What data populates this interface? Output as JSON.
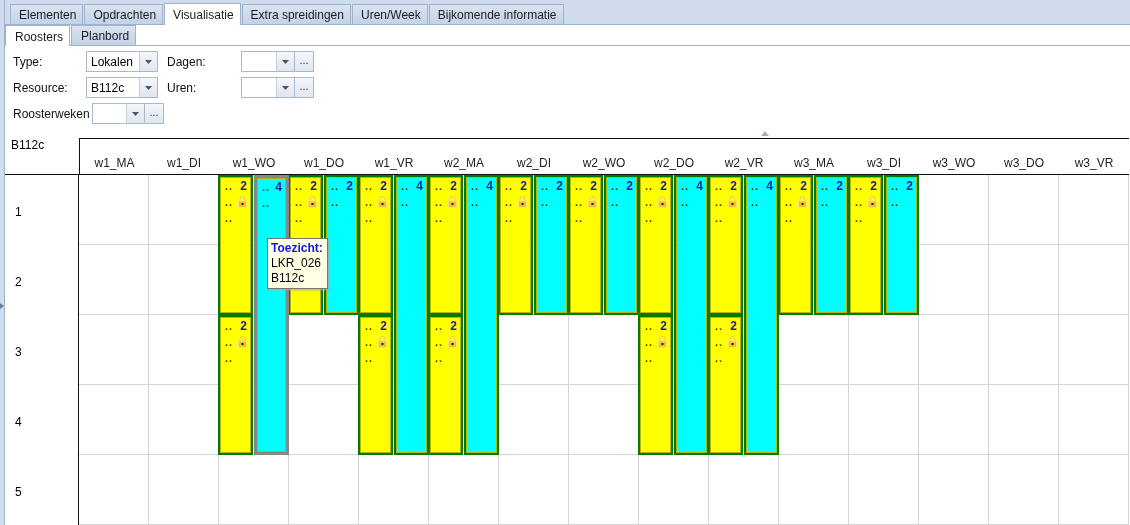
{
  "tabs": [
    {
      "label": "Elementen",
      "selected": false
    },
    {
      "label": "Opdrachten",
      "selected": false
    },
    {
      "label": "Visualisatie",
      "selected": true
    },
    {
      "label": "Extra spreidingen",
      "selected": false
    },
    {
      "label": "Uren/Week",
      "selected": false
    },
    {
      "label": "Bijkomende informatie",
      "selected": false
    }
  ],
  "subtabs": [
    {
      "label": "Roosters",
      "selected": true
    },
    {
      "label": "Planbord",
      "selected": false
    }
  ],
  "filters": [
    [
      {
        "label": "Type:",
        "value": "Lokalen",
        "kind": "combo"
      },
      {
        "label": "Dagen:",
        "kind": "combo-browse",
        "browse": "..."
      }
    ],
    [
      {
        "label": "Resource:",
        "value": "B112c",
        "kind": "combo"
      },
      {
        "label": "Uren:",
        "kind": "combo-browse",
        "browse": "..."
      }
    ],
    [
      {
        "label": "Roosterweken",
        "kind": "combo-browse",
        "browse": "..."
      }
    ]
  ],
  "schedule": {
    "resource": "B112c",
    "rows": [
      "1",
      "2",
      "3",
      "4",
      "5"
    ],
    "columns": [
      {
        "label": "w1_MA"
      },
      {
        "label": "w1_DI"
      },
      {
        "label": "w1_WO",
        "lanes": [
          [
            {
              "kind": "start",
              "color": "#ffff00",
              "count": "2",
              "lines": [
                "..",
                "..",
                ".."
              ],
              "locked": true,
              "selected": false
            },
            {
              "kind": "continued"
            },
            {
              "kind": "start",
              "color": "#ffff00",
              "count": "2",
              "lines": [
                "..",
                "..",
                ".."
              ],
              "locked": true,
              "selected": false
            },
            {
              "kind": "continued"
            },
            {
              "kind": "empty"
            }
          ],
          [
            {
              "kind": "start",
              "color": "#00ffff",
              "count": "4",
              "lines": [
                "..",
                ".."
              ],
              "locked": false,
              "selected": true
            },
            {
              "kind": "continued"
            },
            {
              "kind": "continued"
            },
            {
              "kind": "continued"
            },
            {
              "kind": "empty"
            }
          ]
        ]
      },
      {
        "label": "w1_DO",
        "lanes": [
          [
            {
              "kind": "start",
              "color": "#ffff00",
              "count": "2",
              "lines": [
                "..",
                "..",
                ".."
              ],
              "locked": true,
              "selected": false
            },
            {
              "kind": "continued"
            },
            {
              "kind": "empty"
            },
            {
              "kind": "empty"
            },
            {
              "kind": "empty"
            }
          ],
          [
            {
              "kind": "start",
              "color": "#00ffff",
              "count": "2",
              "lines": [
                "..",
                ".."
              ],
              "locked": false,
              "selected": false
            },
            {
              "kind": "continued"
            },
            {
              "kind": "empty"
            },
            {
              "kind": "empty"
            },
            {
              "kind": "empty"
            }
          ]
        ]
      },
      {
        "label": "w1_VR",
        "lanes": [
          [
            {
              "kind": "start",
              "color": "#ffff00",
              "count": "2",
              "lines": [
                "..",
                "..",
                ".."
              ],
              "locked": true,
              "selected": false
            },
            {
              "kind": "continued"
            },
            {
              "kind": "start",
              "color": "#ffff00",
              "count": "2",
              "lines": [
                "..",
                "..",
                ".."
              ],
              "locked": true,
              "selected": false
            },
            {
              "kind": "continued"
            },
            {
              "kind": "empty"
            }
          ],
          [
            {
              "kind": "start",
              "color": "#00ffff",
              "count": "4",
              "lines": [
                "..",
                ".."
              ],
              "locked": false,
              "selected": false
            },
            {
              "kind": "continued"
            },
            {
              "kind": "continued"
            },
            {
              "kind": "continued"
            },
            {
              "kind": "empty"
            }
          ]
        ]
      },
      {
        "label": "w2_MA",
        "lanes": [
          [
            {
              "kind": "start",
              "color": "#ffff00",
              "count": "2",
              "lines": [
                "..",
                "..",
                ".."
              ],
              "locked": true,
              "selected": false
            },
            {
              "kind": "continued"
            },
            {
              "kind": "start",
              "color": "#ffff00",
              "count": "2",
              "lines": [
                "..",
                "..",
                ".."
              ],
              "locked": true,
              "selected": false
            },
            {
              "kind": "continued"
            },
            {
              "kind": "empty"
            }
          ],
          [
            {
              "kind": "start",
              "color": "#00ffff",
              "count": "4",
              "lines": [
                "..",
                ".."
              ],
              "locked": false,
              "selected": false
            },
            {
              "kind": "continued"
            },
            {
              "kind": "continued"
            },
            {
              "kind": "continued"
            },
            {
              "kind": "empty"
            }
          ]
        ]
      },
      {
        "label": "w2_DI",
        "lanes": [
          [
            {
              "kind": "start",
              "color": "#ffff00",
              "count": "2",
              "lines": [
                "..",
                "..",
                ".."
              ],
              "locked": true,
              "selected": false
            },
            {
              "kind": "continued"
            },
            {
              "kind": "empty"
            },
            {
              "kind": "empty"
            },
            {
              "kind": "empty"
            }
          ],
          [
            {
              "kind": "start",
              "color": "#00ffff",
              "count": "2",
              "lines": [
                "..",
                ".."
              ],
              "locked": false,
              "selected": false
            },
            {
              "kind": "continued"
            },
            {
              "kind": "empty"
            },
            {
              "kind": "empty"
            },
            {
              "kind": "empty"
            }
          ]
        ]
      },
      {
        "label": "w2_WO",
        "lanes": [
          [
            {
              "kind": "start",
              "color": "#ffff00",
              "count": "2",
              "lines": [
                "..",
                "..",
                ".."
              ],
              "locked": true,
              "selected": false
            },
            {
              "kind": "continued"
            },
            {
              "kind": "empty"
            },
            {
              "kind": "empty"
            },
            {
              "kind": "empty"
            }
          ],
          [
            {
              "kind": "start",
              "color": "#00ffff",
              "count": "2",
              "lines": [
                "..",
                ".."
              ],
              "locked": false,
              "selected": false
            },
            {
              "kind": "continued"
            },
            {
              "kind": "empty"
            },
            {
              "kind": "empty"
            },
            {
              "kind": "empty"
            }
          ]
        ]
      },
      {
        "label": "w2_DO",
        "lanes": [
          [
            {
              "kind": "start",
              "color": "#ffff00",
              "count": "2",
              "lines": [
                "..",
                "..",
                ".."
              ],
              "locked": true,
              "selected": false
            },
            {
              "kind": "continued"
            },
            {
              "kind": "start",
              "color": "#ffff00",
              "count": "2",
              "lines": [
                "..",
                "..",
                ".."
              ],
              "locked": true,
              "selected": false
            },
            {
              "kind": "continued"
            },
            {
              "kind": "empty"
            }
          ],
          [
            {
              "kind": "start",
              "color": "#00ffff",
              "count": "4",
              "lines": [
                "..",
                ".."
              ],
              "locked": false,
              "selected": false
            },
            {
              "kind": "continued"
            },
            {
              "kind": "continued"
            },
            {
              "kind": "continued"
            },
            {
              "kind": "empty"
            }
          ]
        ]
      },
      {
        "label": "w2_VR",
        "lanes": [
          [
            {
              "kind": "start",
              "color": "#ffff00",
              "count": "2",
              "lines": [
                "..",
                "..",
                ".."
              ],
              "locked": true,
              "selected": false
            },
            {
              "kind": "continued"
            },
            {
              "kind": "start",
              "color": "#ffff00",
              "count": "2",
              "lines": [
                "..",
                "..",
                ".."
              ],
              "locked": true,
              "selected": false
            },
            {
              "kind": "continued"
            },
            {
              "kind": "empty"
            }
          ],
          [
            {
              "kind": "start",
              "color": "#00ffff",
              "count": "4",
              "lines": [
                "..",
                ".."
              ],
              "locked": false,
              "selected": false
            },
            {
              "kind": "continued"
            },
            {
              "kind": "continued"
            },
            {
              "kind": "continued"
            },
            {
              "kind": "empty"
            }
          ]
        ]
      },
      {
        "label": "w3_MA",
        "lanes": [
          [
            {
              "kind": "start",
              "color": "#ffff00",
              "count": "2",
              "lines": [
                "..",
                "..",
                ".."
              ],
              "locked": true,
              "selected": false
            },
            {
              "kind": "continued"
            },
            {
              "kind": "empty"
            },
            {
              "kind": "empty"
            },
            {
              "kind": "empty"
            }
          ],
          [
            {
              "kind": "start",
              "color": "#00ffff",
              "count": "2",
              "lines": [
                "..",
                ".."
              ],
              "locked": false,
              "selected": false
            },
            {
              "kind": "continued"
            },
            {
              "kind": "empty"
            },
            {
              "kind": "empty"
            },
            {
              "kind": "empty"
            }
          ]
        ]
      },
      {
        "label": "w3_DI",
        "lanes": [
          [
            {
              "kind": "start",
              "color": "#ffff00",
              "count": "2",
              "lines": [
                "..",
                "..",
                ".."
              ],
              "locked": true,
              "selected": false
            },
            {
              "kind": "continued"
            },
            {
              "kind": "empty"
            },
            {
              "kind": "empty"
            },
            {
              "kind": "empty"
            }
          ],
          [
            {
              "kind": "start",
              "color": "#00ffff",
              "count": "2",
              "lines": [
                "..",
                ".."
              ],
              "locked": false,
              "selected": false
            },
            {
              "kind": "continued"
            },
            {
              "kind": "empty"
            },
            {
              "kind": "empty"
            },
            {
              "kind": "empty"
            }
          ]
        ]
      },
      {
        "label": "w3_WO"
      },
      {
        "label": "w3_DO"
      },
      {
        "label": "w3_VR"
      }
    ]
  },
  "tooltip": {
    "title": "Toezicht:",
    "lines": [
      "LKR_026",
      "B112c"
    ]
  }
}
